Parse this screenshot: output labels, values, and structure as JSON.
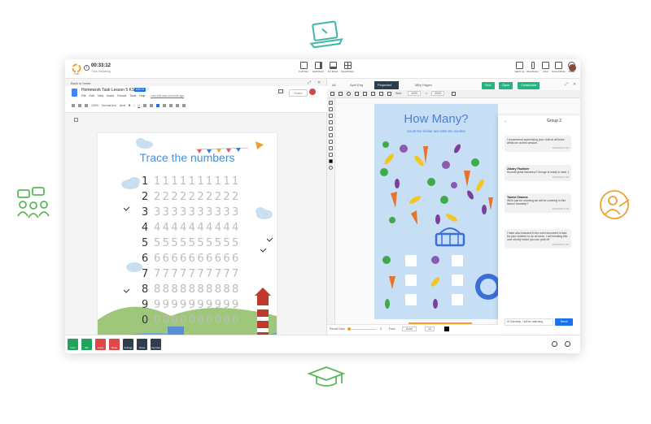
{
  "header": {
    "timer": "00:33:12",
    "timer_sub": "Time remaining",
    "toolbar_items": [
      "Full Size",
      "Half Rows",
      "1/4 Rows",
      "Quad Rows"
    ],
    "right_items": [
      "Hand Up",
      "Rise/Down",
      "Chat",
      "Screenshots",
      "Raise"
    ]
  },
  "docs": {
    "back": "Back to home",
    "title": "Homework Task Lesson 5 KS1",
    "badge": "DOCX",
    "menu": [
      "File",
      "Edit",
      "View",
      "Insert",
      "Format",
      "Tools",
      "Help"
    ],
    "last_edit": "Last edit was seconds ago",
    "share": "Share",
    "zoom": "100%",
    "style": "Normal text",
    "font": "Arial"
  },
  "worksheet": {
    "title": "Trace the numbers",
    "rows": [
      {
        "num": "1",
        "dots": "1111111111"
      },
      {
        "num": "2",
        "dots": "2222222222"
      },
      {
        "num": "3",
        "dots": "3333333333"
      },
      {
        "num": "4",
        "dots": "4444444444"
      },
      {
        "num": "5",
        "dots": "5555555555"
      },
      {
        "num": "6",
        "dots": "6666666666"
      },
      {
        "num": "7",
        "dots": "7777777777"
      },
      {
        "num": "8",
        "dots": "8888888888"
      },
      {
        "num": "9",
        "dots": "9999999999"
      },
      {
        "num": "0",
        "dots": "0000000000"
      }
    ]
  },
  "whiteboard": {
    "tabs": [
      "All",
      "April Eng",
      "Projected",
      "Milly Hagen"
    ],
    "buttons": [
      "New",
      "Open",
      "Collaborate"
    ],
    "size_label": "Size",
    "size_values": [
      "2000",
      "2000"
    ],
    "title": "How Many?",
    "subtitle": "Count the similar and write the number",
    "pencil_label": "Pencil Size",
    "pencil_value": "3",
    "font_label": "Font",
    "font_value": "Arial",
    "font_size": "12"
  },
  "chat": {
    "group": "Group 2",
    "messages": [
      {
        "name": "",
        "text": "I recommend supervising your child at all times whilst we do this session.",
        "time": "00/00/2023 0:00"
      },
      {
        "name": "Zakary Faulkner",
        "text": "Sounds great Sandeep!! George is ready to start :)",
        "time": "00/00/2023 0:00"
      },
      {
        "name": "Taonia Sharma",
        "text": "Will it just be counting we will be covering in this lesson Sandeep?",
        "time": "00/00/2023 0:00"
      },
      {
        "name": "",
        "text": "I have also included in the word document a task for your children to do at home. I will emailing this over shortly which you can print off",
        "time": "00/00/2023 0:00"
      }
    ],
    "input": "Hi Sandeep, I will be watching",
    "send": "Send"
  },
  "bottom": {
    "buttons": [
      {
        "label": "Cam",
        "color": "#21a35e"
      },
      {
        "label": "Mic",
        "color": "#21a35e"
      },
      {
        "label": "Leave",
        "color": "#e04848"
      },
      {
        "label": "Share",
        "color": "#e04848"
      },
      {
        "label": "Settings",
        "color": "#2f3e4e"
      },
      {
        "label": "Views",
        "color": "#2f3e4e"
      },
      {
        "label": "Overview",
        "color": "#2f3e4e"
      }
    ]
  }
}
